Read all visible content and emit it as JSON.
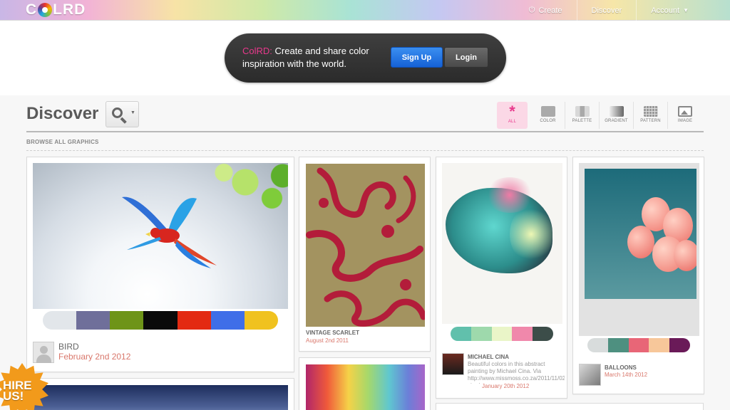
{
  "header": {
    "logo": {
      "left": "C",
      "right": "LRD"
    },
    "nav": [
      {
        "label": "Create",
        "icon": "power-icon"
      },
      {
        "label": "Discover"
      },
      {
        "label": "Account",
        "icon": "caret-down-icon"
      }
    ]
  },
  "promo": {
    "brand": "ColRD:",
    "text": " Create and share color inspiration with the world.",
    "signup_label": "Sign Up",
    "login_label": "Login"
  },
  "discover": {
    "title": "Discover",
    "browse_label": "BROWSE ALL GRAPHICS",
    "filters": [
      {
        "label": "ALL",
        "icon": "asterisk-icon",
        "active": true
      },
      {
        "label": "COLOR",
        "icon": "color-icon"
      },
      {
        "label": "PALETTE",
        "icon": "palette-icon"
      },
      {
        "label": "GRADIENT",
        "icon": "gradient-icon"
      },
      {
        "label": "PATTERN",
        "icon": "pattern-icon"
      },
      {
        "label": "IMAGE",
        "icon": "image-icon"
      }
    ]
  },
  "cards": [
    {
      "title": "BIRD",
      "date": "February 2nd 2012",
      "swatches": [
        "#e2e6ea",
        "#6f6f9a",
        "#6e9418",
        "#0a0a0a",
        "#e32a12",
        "#3f6ee8",
        "#f0c21f"
      ]
    },
    {
      "title": "VINTAGE SCARLET",
      "date": "August 2nd 2011",
      "bg": "#a39360",
      "fg": "#b31c3a"
    },
    {
      "title": "MICHAEL CINA",
      "description": "Beautiful colors in this abstract painting by Michael Cina. Via http://www.missmoss.co.za/2011/11/02/michael-cina/",
      "date": "January 20th 2012",
      "swatches": [
        "#61c0ac",
        "#9ed9ac",
        "#eaf5c8",
        "#f088ab",
        "#3c4d49"
      ]
    },
    {
      "title": "BALLOONS",
      "date": "March 14th 2012",
      "swatches": [
        "#d8dcdc",
        "#4e9080",
        "#e86677",
        "#f7c79a",
        "#6a1a58"
      ]
    }
  ],
  "hire": {
    "line1": "HIRE",
    "line2": "US!"
  }
}
